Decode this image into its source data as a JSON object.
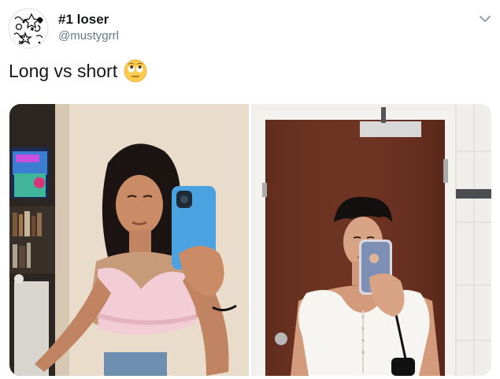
{
  "tweet": {
    "display_name": "#1 loser",
    "handle": "@mustygrrl",
    "text": "Long vs short",
    "emoji": "face-with-rolling-eyes"
  },
  "media": {
    "count": 2,
    "photos": [
      {
        "subject": "long-hair-mirror-selfie"
      },
      {
        "subject": "short-hair-mirror-selfie"
      }
    ]
  },
  "colors": {
    "text_primary": "#14171a",
    "text_secondary": "#657786",
    "caret": "#8899a6"
  }
}
